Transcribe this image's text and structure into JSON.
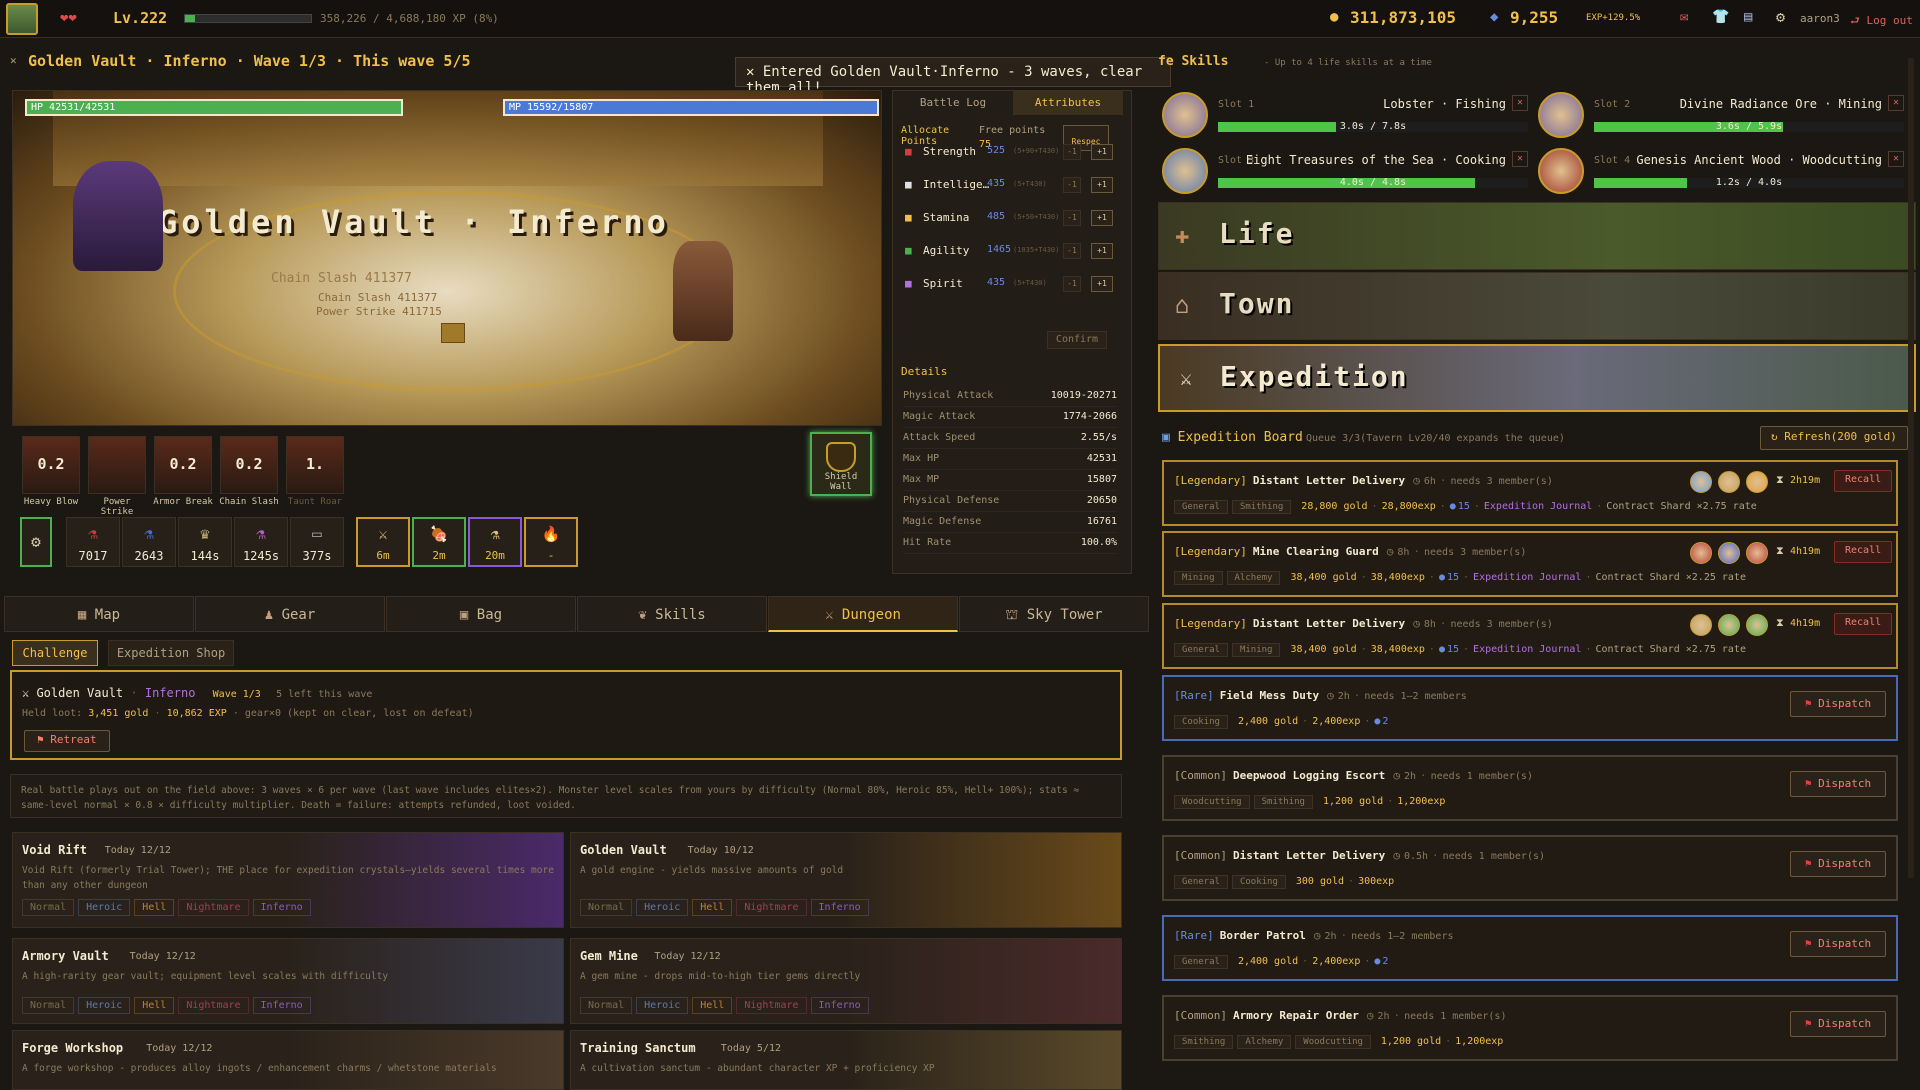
{
  "top": {
    "level": "Lv.222",
    "xp_text": "358,226 / 4,688,180 XP (8%)",
    "xp_fraction": 0.08,
    "gold": "311,873,105",
    "gems": "9,255",
    "exp_bonus": "EXP+129.5%",
    "username": "aaron3",
    "logout": "Log out"
  },
  "dungeon_header": {
    "title": "Golden Vault · Inferno · Wave 1/3 · This wave 5/5",
    "toast": "Entered Golden Vault·Inferno - 3 waves, clear them all!"
  },
  "battle": {
    "hp_text": "HP 42531/42531",
    "mp_text": "MP 15592/15807",
    "hp_fraction": 1.0,
    "mp_fraction": 0.986,
    "banner": "Golden Vault · Inferno",
    "floats": [
      "Chain Slash 411377",
      "Chain Slash 411377",
      "Power Strike 411715"
    ]
  },
  "skills": [
    {
      "cd": "0.2",
      "name": "Heavy Blow"
    },
    {
      "cd": "",
      "name": "Power Strike"
    },
    {
      "cd": "0.2",
      "name": "Armor Break"
    },
    {
      "cd": "0.2",
      "name": "Chain Slash"
    },
    {
      "cd": "1.",
      "name": "Taunt Roar"
    }
  ],
  "shield_skill": "Shield Wall",
  "potions": [
    "7017",
    "2643",
    "144s",
    "1245s",
    "377s"
  ],
  "buffs": [
    "6m",
    "2m",
    "20m",
    "-"
  ],
  "side_tabs": {
    "log": "Battle Log",
    "attr": "Attributes"
  },
  "attributes": {
    "allocate": "Allocate Points",
    "free_label": "Free points",
    "free": "75",
    "respec": "Respec",
    "confirm": "Confirm",
    "rows": [
      {
        "name": "Strength",
        "val": "525",
        "sub": "(5+90+T430)"
      },
      {
        "name": "Intellige…",
        "val": "435",
        "sub": "(5+T430)"
      },
      {
        "name": "Stamina",
        "val": "485",
        "sub": "(5+50+T430)"
      },
      {
        "name": "Agility",
        "val": "1465",
        "sub": "(1035+T430)"
      },
      {
        "name": "Spirit",
        "val": "435",
        "sub": "(5+T430)"
      }
    ],
    "minus": "-1",
    "plus": "+1"
  },
  "details": {
    "title": "Details",
    "rows": [
      {
        "k": "Physical Attack",
        "v": "10019-20271"
      },
      {
        "k": "Magic Attack",
        "v": "1774-2066"
      },
      {
        "k": "Attack Speed",
        "v": "2.55/s"
      },
      {
        "k": "Max HP",
        "v": "42531"
      },
      {
        "k": "Max MP",
        "v": "15807"
      },
      {
        "k": "Physical Defense",
        "v": "20650"
      },
      {
        "k": "Magic Defense",
        "v": "16761"
      },
      {
        "k": "Hit Rate",
        "v": "100.0%"
      }
    ]
  },
  "main_tabs": [
    "Map",
    "Gear",
    "Bag",
    "Skills",
    "Dungeon",
    "Sky Tower"
  ],
  "sub_tabs": [
    "Challenge",
    "Expedition Shop"
  ],
  "current": {
    "title": "Golden Vault",
    "diff": "Inferno",
    "wave": "Wave 1/3",
    "left": "5 left this wave",
    "loot_label": "Held loot:",
    "loot_gold": "3,451 gold",
    "loot_exp": "10,862 EXP",
    "loot_note": "· gear×0 (kept on clear, lost on defeat)",
    "retreat": "Retreat"
  },
  "info_text": "Real battle plays out on the field above: 3 waves × 6 per wave (last wave includes elites×2). Monster level scales from yours by difficulty (Normal 80%, Heroic 85%, Hell+ 100%); stats ≈ same-level normal × 0.8 × difficulty multiplier. Death = failure: attempts refunded, loot voided.",
  "difficulties": [
    "Normal",
    "Heroic",
    "Hell",
    "Nightmare",
    "Inferno"
  ],
  "dungeons": [
    {
      "name": "Void Rift",
      "today": "Today 12/12",
      "desc": "Void Rift (formerly Trial Tower); THE place for expedition crystals—yields several times more than any other dungeon"
    },
    {
      "name": "Golden Vault",
      "today": "Today 10/12",
      "desc": "A gold engine - yields massive amounts of gold"
    },
    {
      "name": "Armory Vault",
      "today": "Today 12/12",
      "desc": "A high-rarity gear vault; equipment level scales with difficulty"
    },
    {
      "name": "Gem Mine",
      "today": "Today 12/12",
      "desc": "A gem mine - drops mid-to-high tier gems directly"
    },
    {
      "name": "Forge Workshop",
      "today": "Today 12/12",
      "desc": "A forge workshop - produces alloy ingots / enhancement charms / whetstone materials"
    },
    {
      "name": "Training Sanctum",
      "today": "Today 5/12",
      "desc": "A cultivation sanctum - abundant character XP + proficiency XP"
    }
  ],
  "life_skills": {
    "title": "fe Skills",
    "sub": "- Up to 4 life skills at a time",
    "slots": [
      {
        "slot": "Slot 1",
        "task": "Lobster · Fishing",
        "prog": "3.0s / 7.8s",
        "frac": 0.38
      },
      {
        "slot": "Slot 2",
        "task": "Divine Radiance Ore · Mining",
        "prog": "3.6s / 5.9s",
        "frac": 0.61
      },
      {
        "slot": "Slot 3",
        "task": "Eight Treasures of the Sea · Cooking",
        "prog": "4.0s / 4.8s",
        "frac": 0.83
      },
      {
        "slot": "Slot 4",
        "task": "Genesis Ancient Wood · Woodcutting",
        "prog": "1.2s / 4.0s",
        "frac": 0.3
      }
    ]
  },
  "areas": [
    "Life",
    "Town",
    "Expedition"
  ],
  "board": {
    "title": "Expedition Board",
    "queue": "Queue 3/3(Tavern Lv20/40 expands the queue)",
    "refresh": "Refresh(200 gold)"
  },
  "expeditions": [
    {
      "rarity": "[Legendary]",
      "name": "Distant Letter Delivery",
      "time": "6h",
      "need": "needs 3 member(s)",
      "tags": [
        "General",
        "Smithing"
      ],
      "gold": "28,800 gold",
      "exp": "28,800exp",
      "crys": "15",
      "journal": "Expedition Journal",
      "shard": "Contract Shard ×2.75 rate",
      "timer": "2h19m",
      "action": "Recall",
      "kind": "legend"
    },
    {
      "rarity": "[Legendary]",
      "name": "Mine Clearing Guard",
      "time": "8h",
      "need": "needs 3 member(s)",
      "tags": [
        "Mining",
        "Alchemy"
      ],
      "gold": "38,400 gold",
      "exp": "38,400exp",
      "crys": "15",
      "journal": "Expedition Journal",
      "shard": "Contract Shard ×2.25 rate",
      "timer": "4h19m",
      "action": "Recall",
      "kind": "legend"
    },
    {
      "rarity": "[Legendary]",
      "name": "Distant Letter Delivery",
      "time": "8h",
      "need": "needs 3 member(s)",
      "tags": [
        "General",
        "Mining"
      ],
      "gold": "38,400 gold",
      "exp": "38,400exp",
      "crys": "15",
      "journal": "Expedition Journal",
      "shard": "Contract Shard ×2.75 rate",
      "timer": "4h19m",
      "action": "Recall",
      "kind": "legend"
    },
    {
      "rarity": "[Rare]",
      "name": "Field Mess Duty",
      "time": "2h",
      "need": "needs 1–2 members",
      "tags": [
        "Cooking"
      ],
      "gold": "2,400 gold",
      "exp": "2,400exp",
      "crys": "2",
      "journal": "",
      "shard": "",
      "timer": "",
      "action": "Dispatch",
      "kind": "rare"
    },
    {
      "rarity": "[Common]",
      "name": "Deepwood Logging Escort",
      "time": "2h",
      "need": "needs 1 member(s)",
      "tags": [
        "Woodcutting",
        "Smithing"
      ],
      "gold": "1,200 gold",
      "exp": "1,200exp",
      "crys": "",
      "journal": "",
      "shard": "",
      "timer": "",
      "action": "Dispatch",
      "kind": "common"
    },
    {
      "rarity": "[Common]",
      "name": "Distant Letter Delivery",
      "time": "0.5h",
      "need": "needs 1 member(s)",
      "tags": [
        "General",
        "Cooking"
      ],
      "gold": "300 gold",
      "exp": "300exp",
      "crys": "",
      "journal": "",
      "shard": "",
      "timer": "",
      "action": "Dispatch",
      "kind": "common"
    },
    {
      "rarity": "[Rare]",
      "name": "Border Patrol",
      "time": "2h",
      "need": "needs 1–2 members",
      "tags": [
        "General"
      ],
      "gold": "2,400 gold",
      "exp": "2,400exp",
      "crys": "2",
      "journal": "",
      "shard": "",
      "timer": "",
      "action": "Dispatch",
      "kind": "rare"
    },
    {
      "rarity": "[Common]",
      "name": "Armory Repair Order",
      "time": "2h",
      "need": "needs 1 member(s)",
      "tags": [
        "Smithing",
        "Alchemy",
        "Woodcutting"
      ],
      "gold": "1,200 gold",
      "exp": "1,200exp",
      "crys": "",
      "journal": "",
      "shard": "",
      "timer": "",
      "action": "Dispatch",
      "kind": "common"
    }
  ],
  "colors": {
    "gold": "#f0c04a",
    "hp": "#4caf50",
    "mp": "#4a7ad6",
    "legendary": "#b48a2e",
    "rare": "#4a6ab8",
    "accent_red": "#f08070"
  }
}
